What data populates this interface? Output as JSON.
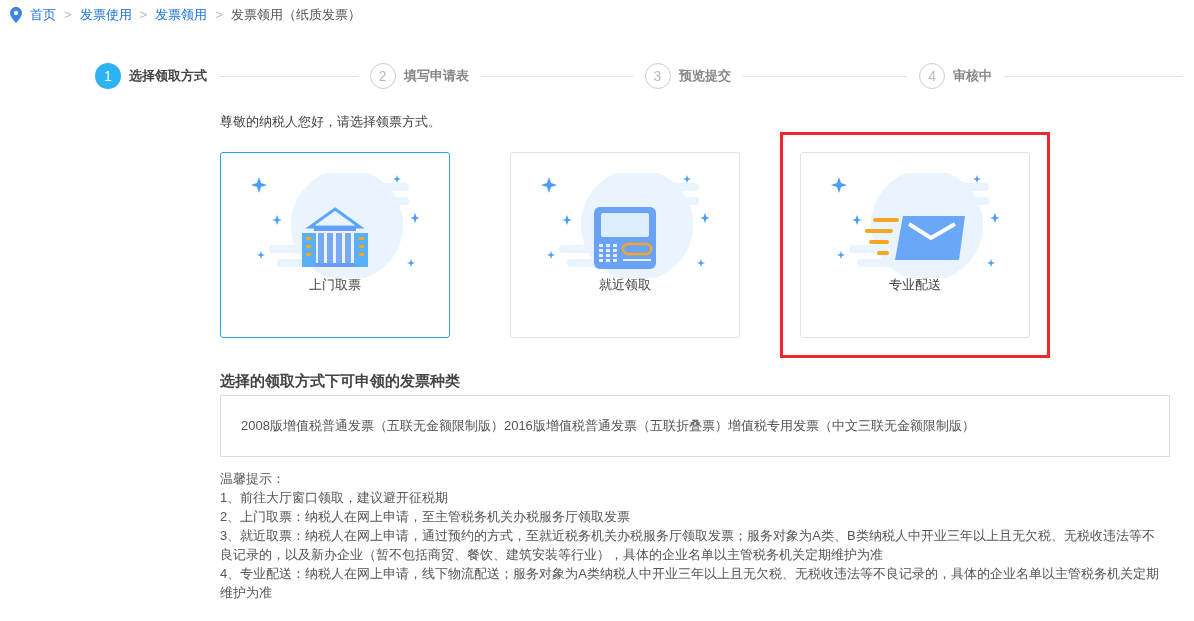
{
  "breadcrumb": [
    {
      "label": "首页",
      "link": true
    },
    {
      "label": "发票使用",
      "link": true
    },
    {
      "label": "发票领用",
      "link": true
    },
    {
      "label": "发票领用（纸质发票）",
      "link": false
    }
  ],
  "breadcrumb_separator": ">",
  "steps": [
    {
      "number": "1",
      "label": "选择领取方式",
      "selected": true
    },
    {
      "number": "2",
      "label": "填写申请表",
      "selected": false
    },
    {
      "number": "3",
      "label": "预览提交",
      "selected": false
    },
    {
      "number": "4",
      "label": "审核中",
      "selected": false
    }
  ],
  "greeting": "尊敬的纳税人您好，请选择领票方式。",
  "options": [
    {
      "kind": "building",
      "label": "上门取票",
      "selected": true,
      "highlighted": false
    },
    {
      "kind": "terminal",
      "label": "就近领取",
      "selected": false,
      "highlighted": false
    },
    {
      "kind": "mail",
      "label": "专业配送",
      "selected": false,
      "highlighted": true
    }
  ],
  "invoice_types": {
    "title": "选择的领取方式下可申领的发票种类",
    "text": "2008版增值税普通发票（五联无金额限制版）2016版增值税普通发票（五联折叠票）增值税专用发票（中文三联无金额限制版）"
  },
  "tips": {
    "title": "温馨提示：",
    "lines": [
      "1、前往大厅窗口领取，建议避开征税期",
      "2、上门取票：纳税人在网上申请，至主管税务机关办税服务厅领取发票",
      "3、就近取票：纳税人在网上申请，通过预约的方式，至就近税务机关办税服务厅领取发票；服务对象为A类、B类纳税人中开业三年以上且无欠税、无税收违法等不良记录的，以及新办企业（暂不包括商贸、餐饮、建筑安装等行业），具体的企业名单以主管税务机关定期维护为准",
      "4、专业配送：纳税人在网上申请，线下物流配送；服务对象为A类纳税人中开业三年以上且无欠税、无税收违法等不良记录的，具体的企业名单以主管税务机关定期维护为准"
    ]
  }
}
